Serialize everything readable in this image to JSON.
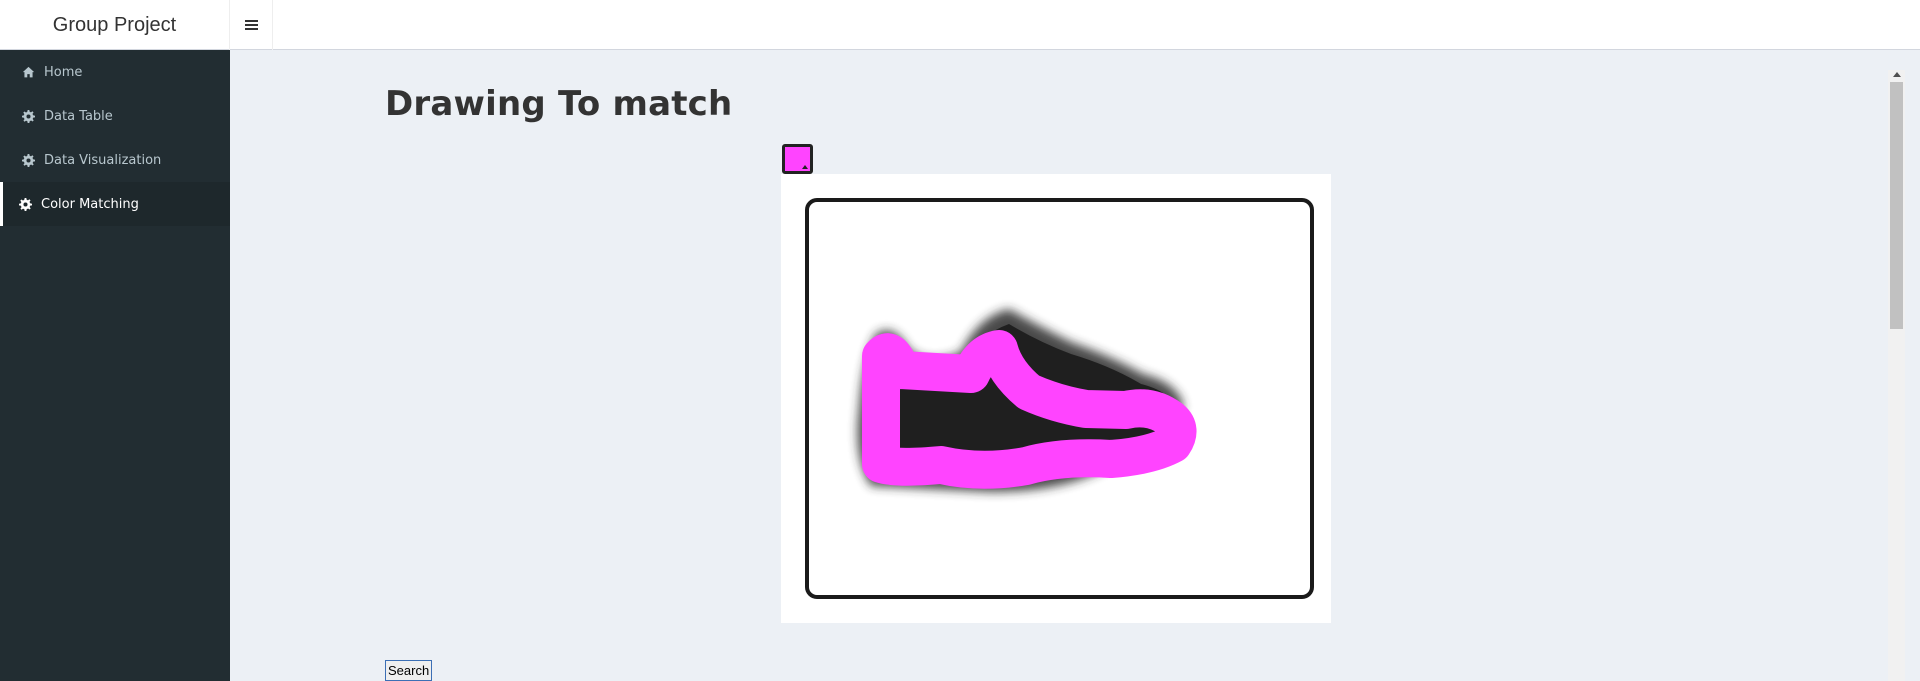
{
  "app": {
    "title": "Group Project"
  },
  "sidebar": {
    "items": [
      {
        "label": "Home",
        "icon": "home-icon"
      },
      {
        "label": "Data Table",
        "icon": "gear-icon"
      },
      {
        "label": "Data Visualization",
        "icon": "gear-icon"
      },
      {
        "label": "Color Matching",
        "icon": "gear-icon",
        "active": true
      }
    ]
  },
  "main": {
    "title": "Drawing To match",
    "color_picker": {
      "selected_color": "#ff44ff"
    },
    "search_label": "Search"
  },
  "colors": {
    "sidebar_bg": "#222d32",
    "sidebar_active_bg": "#1e282c",
    "content_bg": "#ecf0f5",
    "brush": "#ff44ff"
  }
}
